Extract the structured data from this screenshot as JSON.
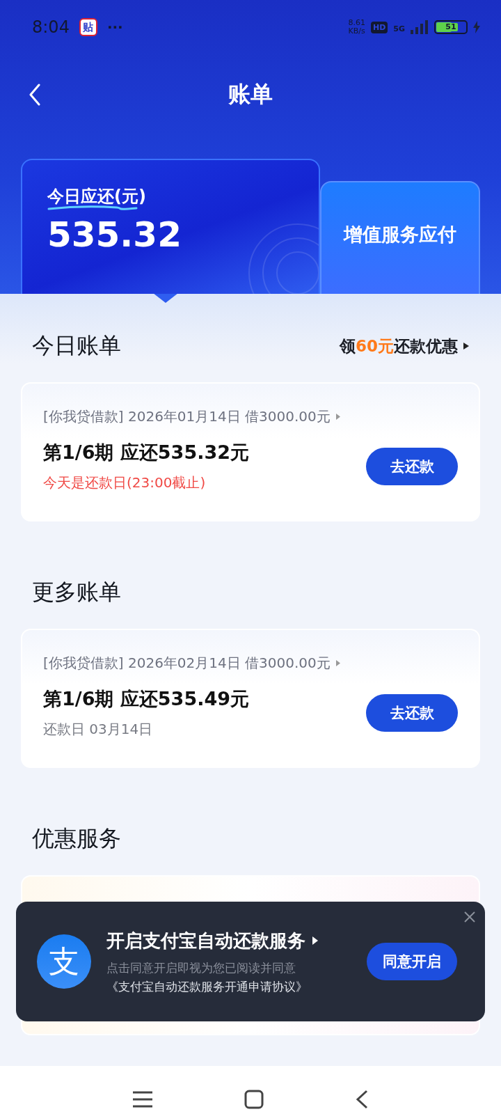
{
  "status_bar": {
    "time": "8:04",
    "app_icon_label": "贴",
    "more": "···",
    "net_speed": "8.61",
    "net_unit": "KB/s",
    "hd": "HD",
    "network": "5G",
    "battery": "51",
    "charging": true
  },
  "header": {
    "title": "账单"
  },
  "summary_tabs": [
    {
      "kind": "amount",
      "label": "今日应还(元)",
      "amount": "535.32",
      "selected": true
    },
    {
      "kind": "plain",
      "label": "增值服务应付",
      "selected": false
    }
  ],
  "today": {
    "title": "今日账单",
    "promo_prefix": "领",
    "promo_highlight": "60元",
    "promo_suffix": "还款优惠",
    "bills": [
      {
        "source": "[你我贷借款] 2026年01月14日 借3000.00元",
        "installment": "第1/6期 应还535.32元",
        "due": "今天是还款日(23:00截止)",
        "urgent": true,
        "button": "去还款"
      }
    ]
  },
  "more": {
    "title": "更多账单",
    "bills": [
      {
        "source": "[你我贷借款] 2026年02月14日 借3000.00元",
        "installment": "第1/6期 应还535.49元",
        "due": "还款日 03月14日",
        "urgent": false,
        "button": "去还款"
      }
    ]
  },
  "offers": {
    "title": "优惠服务"
  },
  "banner": {
    "logo_label": "支",
    "title": "开启支付宝自动还款服务",
    "note": "点击同意开启即视为您已阅读并同意",
    "agreement": "《支付宝自动还款服务开通申请协议》",
    "button": "同意开启"
  }
}
